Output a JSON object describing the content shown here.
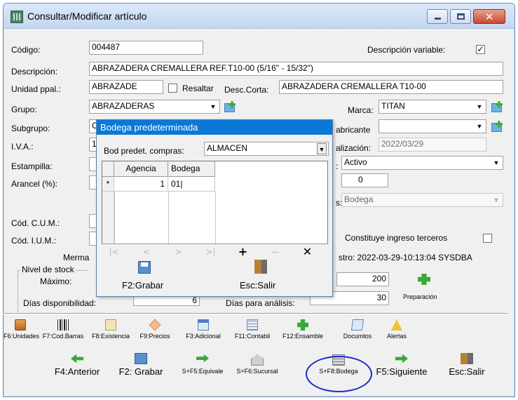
{
  "window": {
    "title": "Consultar/Modificar artículo"
  },
  "form": {
    "codigo_label": "Código:",
    "codigo_value": "004487",
    "descripcion_variable_label": "Descripción variable:",
    "descripcion_variable_checked": true,
    "descripcion_label": "Descripción:",
    "descripcion_value": "ABRAZADERA CREMALLERA REF.T10-00  (5/16\" - 15/32\")",
    "unidad_label": "Unidad ppal.:",
    "unidad_value": "ABRAZADE",
    "resaltar_label": "Resaltar",
    "desc_corta_label": "Desc.Corta:",
    "desc_corta_value": "ABRAZADERA CREMALLERA T10-00",
    "grupo_label": "Grupo:",
    "grupo_value": "ABRAZADERAS",
    "marca_label": "Marca:",
    "marca_value": "TITAN",
    "subgrupo_label": "Subgrupo:",
    "subgrupo_value_partial": "C",
    "fabricante_label": "abricante",
    "fabricante_value": "",
    "iva_label": "I.V.A.:",
    "iva_value_partial": "1",
    "actualizacion_label": "alización:",
    "actualizacion_value": "2022/03/29",
    "estampilla_label": "Estampilla:",
    "estado_label": ":",
    "estado_value": "Activo",
    "arancel_label": "Arancel (%):",
    "small_value": "0",
    "tipo_label": "s:",
    "tipo_value": "Bodega",
    "cum_label": "Cód. C.U.M.:",
    "ium_label": "Cód. I.U.M.:",
    "ingreso_terceros_label": "Constituye ingreso terceros",
    "merma_label": "Merma",
    "registro_text": "stro: 2022-03-29-10:13:04 SYSDBA",
    "nivel_stock_label": "Nivel de stock",
    "maximo_label": "Máximo:",
    "maximo_value": "200",
    "preparacion_label": "Preparación",
    "dias_disp_label": "Días disponibilidad:",
    "dias_disp_value": "6",
    "dias_analisis_label": "Días para análisis:",
    "dias_analisis_value": "30"
  },
  "popup": {
    "title": "Bodega predeterminada",
    "bod_compras_label": "Bod predet. compras:",
    "bod_compras_value": "ALMACEN",
    "grid": {
      "headers": [
        "Agencia",
        "Bodega"
      ],
      "row_indicator": "*",
      "rows": [
        [
          "1",
          "01|"
        ]
      ]
    },
    "nav": [
      "|<",
      "<",
      ">",
      ">|",
      "+",
      "—",
      "✕"
    ],
    "save_label": "F2:Grabar",
    "exit_label": "Esc:Salir"
  },
  "toolbar_row1": [
    {
      "label": "F6:Unidades",
      "icon": "box-icon"
    },
    {
      "label": "F7:Cod.Barras",
      "icon": "barcode-icon"
    },
    {
      "label": "F8:Existencia",
      "icon": "document-icon"
    },
    {
      "label": "F9:Precios",
      "icon": "tag-icon"
    },
    {
      "label": "F3:Adicional",
      "icon": "window-icon"
    },
    {
      "label": "F11:Contabil",
      "icon": "ledger-icon"
    },
    {
      "label": "F12:Ensamble",
      "icon": "puzzle-icon"
    },
    {
      "label": "Documtos",
      "icon": "book-icon"
    },
    {
      "label": "Alertas",
      "icon": "warning-icon"
    }
  ],
  "toolbar_row2": [
    {
      "label": "F4:Anterior",
      "icon": "arrow-left-icon"
    },
    {
      "label": "F2: Grabar",
      "icon": "save-icon"
    },
    {
      "label": "S+F5:Equivale",
      "icon": "equivalence-icon"
    },
    {
      "label": "S+F6:Sucursal",
      "icon": "building-icon"
    },
    {
      "label": "S+F8:Bodega",
      "icon": "warehouse-icon"
    },
    {
      "label": "F5:Siguiente",
      "icon": "arrow-right-icon"
    },
    {
      "label": "Esc:Salir",
      "icon": "exit-door-icon"
    }
  ],
  "colors": {
    "popup_title_bg": "#0a78d7",
    "highlight_ring": "#1d2ccf",
    "close_button": "#c74a32"
  }
}
